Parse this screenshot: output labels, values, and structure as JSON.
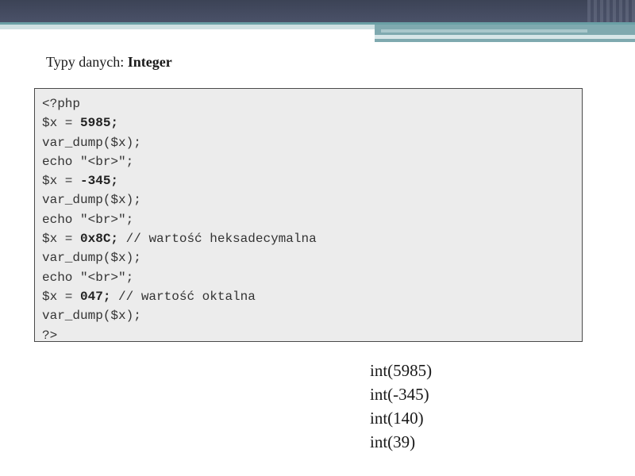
{
  "slide": {
    "title_prefix": "Typy danych: ",
    "title_keyword": "Integer"
  },
  "code": {
    "lines": [
      {
        "pre": "<?php",
        "bold": "",
        "post": ""
      },
      {
        "pre": "$x = ",
        "bold": "5985;",
        "post": ""
      },
      {
        "pre": "var_dump($x);",
        "bold": "",
        "post": ""
      },
      {
        "pre": "echo \"<br>\";",
        "bold": "",
        "post": ""
      },
      {
        "pre": "$x = ",
        "bold": "-345;",
        "post": ""
      },
      {
        "pre": "var_dump($x);",
        "bold": "",
        "post": ""
      },
      {
        "pre": "echo \"<br>\";",
        "bold": "",
        "post": ""
      },
      {
        "pre": "$x = ",
        "bold": "0x8C;",
        "post": " // wartość heksadecymalna"
      },
      {
        "pre": "var_dump($x);",
        "bold": "",
        "post": ""
      },
      {
        "pre": "echo \"<br>\";",
        "bold": "",
        "post": ""
      },
      {
        "pre": "$x = ",
        "bold": "047;",
        "post": " // wartość oktalna"
      },
      {
        "pre": "var_dump($x);",
        "bold": "",
        "post": ""
      },
      {
        "pre": "?>",
        "bold": "",
        "post": ""
      }
    ]
  },
  "output": {
    "lines": [
      "int(5985)",
      "int(-345)",
      "int(140)",
      "int(39)"
    ]
  },
  "colors": {
    "header_dark": "#3c4356",
    "header_teal": "#6a9fa5",
    "code_background": "#ececec"
  }
}
